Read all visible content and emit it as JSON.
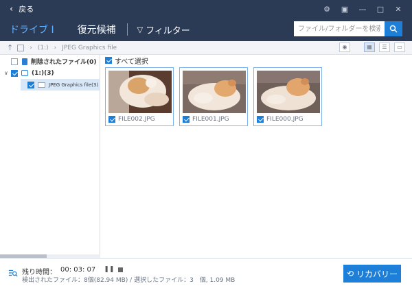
{
  "titlebar": {
    "back_label": "戻る",
    "controls": [
      "⚙",
      "▣",
      "—",
      "□",
      "✕"
    ]
  },
  "header": {
    "tab_drive": "ドライブ I",
    "tab_recovery": "復元候補",
    "filter_label": "フィルター",
    "search_placeholder": "ファイル/フォルダーを検索"
  },
  "pathbar": {
    "crumb_drive": "(1:)",
    "crumb_folder": "JPEG Graphics file"
  },
  "sidebar": {
    "deleted_files": "削除されたファイル(0)",
    "drive_node": "(1:)(3)",
    "folder_node": "JPEG Graphics file(3)"
  },
  "main": {
    "select_all": "すべて選択",
    "files": [
      {
        "name": "FILE002.JPG"
      },
      {
        "name": "FILE001.JPG"
      },
      {
        "name": "FILE000.JPG"
      }
    ]
  },
  "status": {
    "remaining_label": "残り時間：",
    "remaining_time": "00: 03: 07",
    "detail": "検出されたファイル：8個(82.94 MB) / 選択したファイル：3　個, 1.09 MB",
    "recover_label": "リカバリー"
  },
  "colors": {
    "header_bg": "#2b3a55",
    "accent": "#1e7fd8",
    "active_tab": "#5fb0ff"
  }
}
